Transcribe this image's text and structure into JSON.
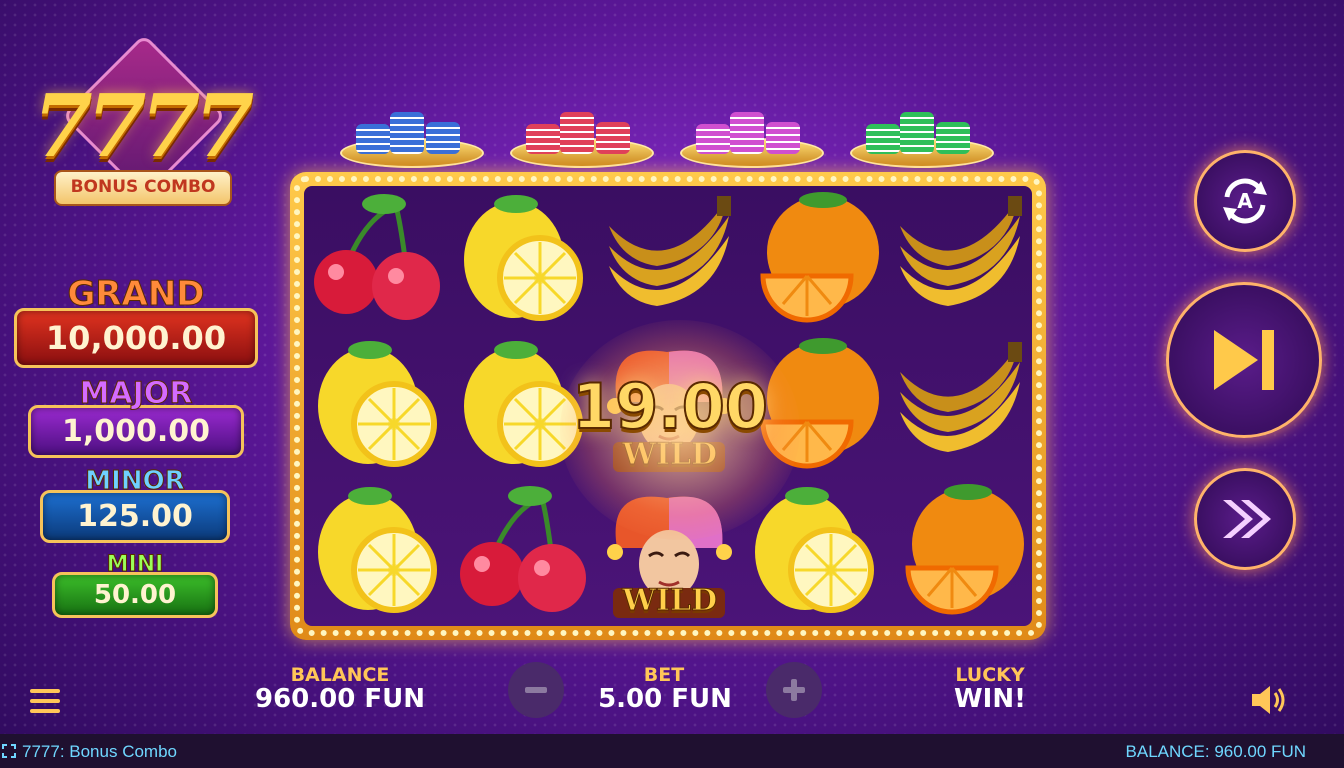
{
  "game": {
    "logo_number": "7777",
    "logo_subtitle": "BONUS COMBO"
  },
  "jackpots": {
    "grand": {
      "name": "GRAND",
      "value": "10,000.00"
    },
    "major": {
      "name": "MAJOR",
      "value": "1,000.00"
    },
    "minor": {
      "name": "MINOR",
      "value": "125.00"
    },
    "mini": {
      "name": "MINI",
      "value": "50.00"
    }
  },
  "chip_stacks": [
    {
      "color": "#3a6fd8"
    },
    {
      "color": "#e0405a"
    },
    {
      "color": "#d04fd0"
    },
    {
      "color": "#2fbf5a"
    }
  ],
  "reels": [
    [
      "cherry",
      "lemon",
      "lemon"
    ],
    [
      "lemon",
      "lemon",
      "cherry"
    ],
    [
      "banana",
      "wild",
      "wild"
    ],
    [
      "orange",
      "orange",
      "lemon"
    ],
    [
      "banana",
      "banana",
      "orange"
    ]
  ],
  "wild_label": "WILD",
  "win": {
    "amount": "19.00"
  },
  "controls": {
    "autoplay_icon": "A",
    "balance_label": "BALANCE",
    "balance_value": "960.00 FUN",
    "bet_label": "BET",
    "bet_value": "5.00 FUN",
    "lucky_label": "LUCKY",
    "lucky_value": "WIN!"
  },
  "status_bar": {
    "title": "7777: Bonus Combo",
    "balance": "BALANCE: 960.00 FUN"
  }
}
